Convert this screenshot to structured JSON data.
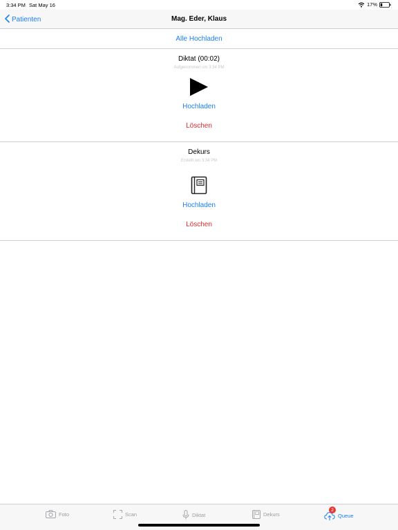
{
  "status": {
    "time": "3:34 PM",
    "date": "Sat May 16",
    "battery": "17%"
  },
  "nav": {
    "back_label": "Patienten",
    "title": "Mag. Eder, Klaus"
  },
  "upload_all_label": "Alle Hochladen",
  "entries": [
    {
      "title": "Diktat (00:02)",
      "subtitle": "Aufgenommen um 3:34 PM",
      "icon": "play-icon",
      "upload_label": "Hochladen",
      "delete_label": "Löschen"
    },
    {
      "title": "Dekurs",
      "subtitle": "Erstellt um 3:34 PM",
      "icon": "book-icon",
      "upload_label": "Hochladen",
      "delete_label": "Löschen"
    }
  ],
  "tabs": [
    {
      "label": "Foto",
      "icon": "camera-icon"
    },
    {
      "label": "Scan",
      "icon": "scan-icon"
    },
    {
      "label": "Diktat",
      "icon": "microphone-icon"
    },
    {
      "label": "Dekurs",
      "icon": "book-icon"
    },
    {
      "label": "Queue",
      "icon": "cloud-upload-icon",
      "badge": "2",
      "selected": true
    }
  ],
  "colors": {
    "accent": "#1a7ef5",
    "destructive": "#e0292b",
    "badge": "#e53935",
    "inactive_tab": "#9b9ba0"
  }
}
